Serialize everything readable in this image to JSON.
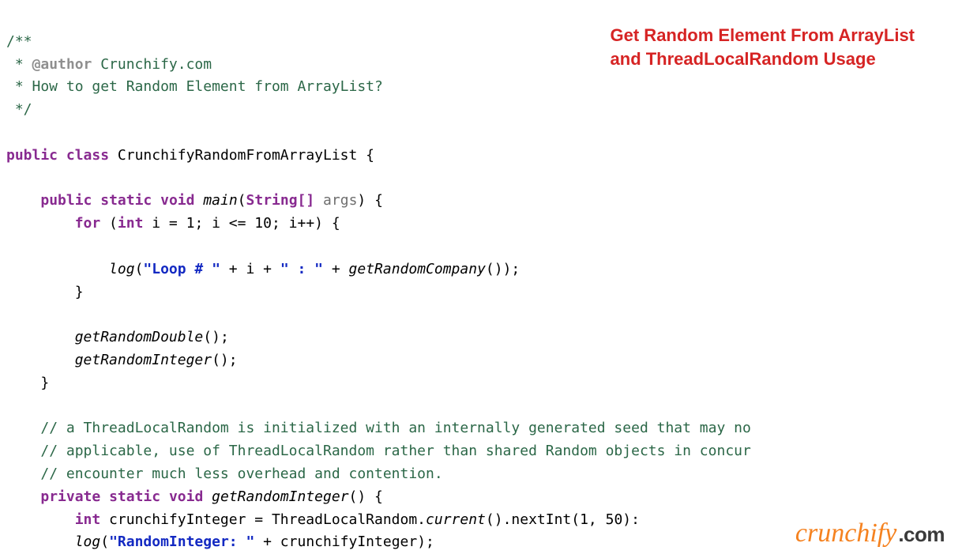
{
  "title": {
    "line1": "Get Random Element From ArrayList",
    "line2": "and ThreadLocalRandom Usage"
  },
  "code": {
    "c_open": "/**",
    "c_author_star": " * ",
    "c_author_tag": "@author",
    "c_author_val": " Crunchify.com",
    "c_desc": " * How to get Random Element from ArrayList?",
    "c_close": " */",
    "kw_public": "public",
    "kw_class": "class",
    "classname": "CrunchifyRandomFromArrayList",
    "brace_o": " {",
    "kw_static": "static",
    "kw_void": "void",
    "m_main": "main",
    "paren_o": "(",
    "t_string_arr": "String[]",
    "p_args": " args",
    "paren_c_brace": ") {",
    "kw_for": "for",
    "for_open": " (",
    "kw_int": "int",
    "for_init": " i = 1; i <= 10; i++) {",
    "m_log": "log",
    "s_loop": "\"Loop # \"",
    "plus_i_plus": " + i + ",
    "s_colon": "\" : \"",
    "plus": " + ",
    "m_getRandomCompany": "getRandomCompany",
    "call_end": "());",
    "brace_c": "}",
    "m_getRandomDouble": "getRandomDouble",
    "call_empty": "();",
    "m_getRandomInteger": "getRandomInteger",
    "c_tlr1": "// a ThreadLocalRandom is initialized with an internally generated seed that may no",
    "c_tlr2": "// applicable, use of ThreadLocalRandom rather than shared Random objects in concur",
    "c_tlr3": "// encounter much less overhead and contention.",
    "kw_private": "private",
    "m_getRandomInteger2": "getRandomInteger",
    "paren_c_brace2": "() {",
    "var_crunchifyInt": " crunchifyInteger = ThreadLocalRandom.",
    "m_current": "current",
    "call_next": "().nextInt(1, 50):",
    "s_randint": "\"RandomInteger: \"",
    "plus_var": " + crunchifyInteger);"
  },
  "logo": {
    "brand": "crunchify",
    "suffix": ".com"
  }
}
